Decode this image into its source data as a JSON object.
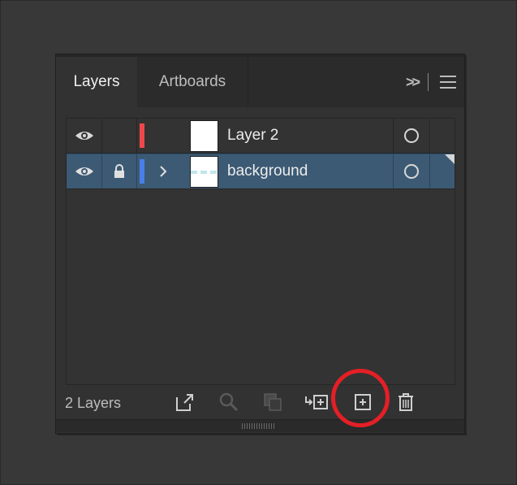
{
  "tabs": [
    {
      "label": "Layers",
      "active": true
    },
    {
      "label": "Artboards",
      "active": false
    }
  ],
  "layers": [
    {
      "name": "Layer 2",
      "visible": true,
      "locked": false,
      "color": "#f0484a",
      "expandable": false,
      "selected": false
    },
    {
      "name": "background",
      "visible": true,
      "locked": true,
      "color": "#4a7fe8",
      "expandable": true,
      "selected": true
    }
  ],
  "footer": {
    "count_label": "2 Layers",
    "icons": [
      "export-icon",
      "search-icon",
      "clipping-mask-icon",
      "new-sublayer-icon",
      "new-layer-icon",
      "trash-icon"
    ]
  },
  "colors": {
    "panel": "#323232",
    "selected_row": "#3c5a74",
    "highlight": "#e41f26"
  }
}
